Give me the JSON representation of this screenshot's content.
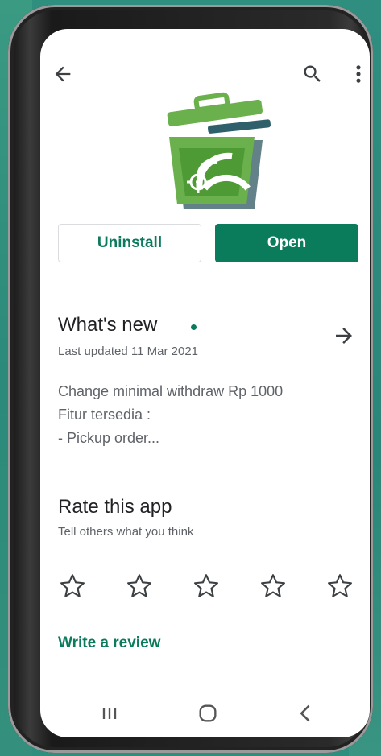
{
  "header": {
    "back_icon": "arrow-back-icon",
    "search_icon": "search-icon",
    "more_icon": "more-vertical-icon"
  },
  "app": {
    "logo": "trash-bin-wifi-logo",
    "colors": {
      "logo_green": "#6ab04c",
      "logo_dark": "#2f5f6a"
    }
  },
  "actions": {
    "uninstall_label": "Uninstall",
    "open_label": "Open"
  },
  "whats_new": {
    "title": "What's new",
    "last_updated": "Last updated 11 Mar 2021",
    "notes": [
      "Change minimal withdraw Rp 1000",
      "Fitur tersedia :",
      "- Pickup order..."
    ]
  },
  "rate": {
    "title": "Rate this app",
    "subtitle": "Tell others what you think",
    "star_count": 5,
    "rating": 0
  },
  "write_review_label": "Write a review",
  "navbar": {
    "items": [
      "recent-apps-icon",
      "home-icon",
      "back-icon"
    ]
  },
  "colors": {
    "accent": "#0a7b5b",
    "background": "#ffffff",
    "text_primary": "#202124",
    "text_secondary": "#5f6368"
  }
}
